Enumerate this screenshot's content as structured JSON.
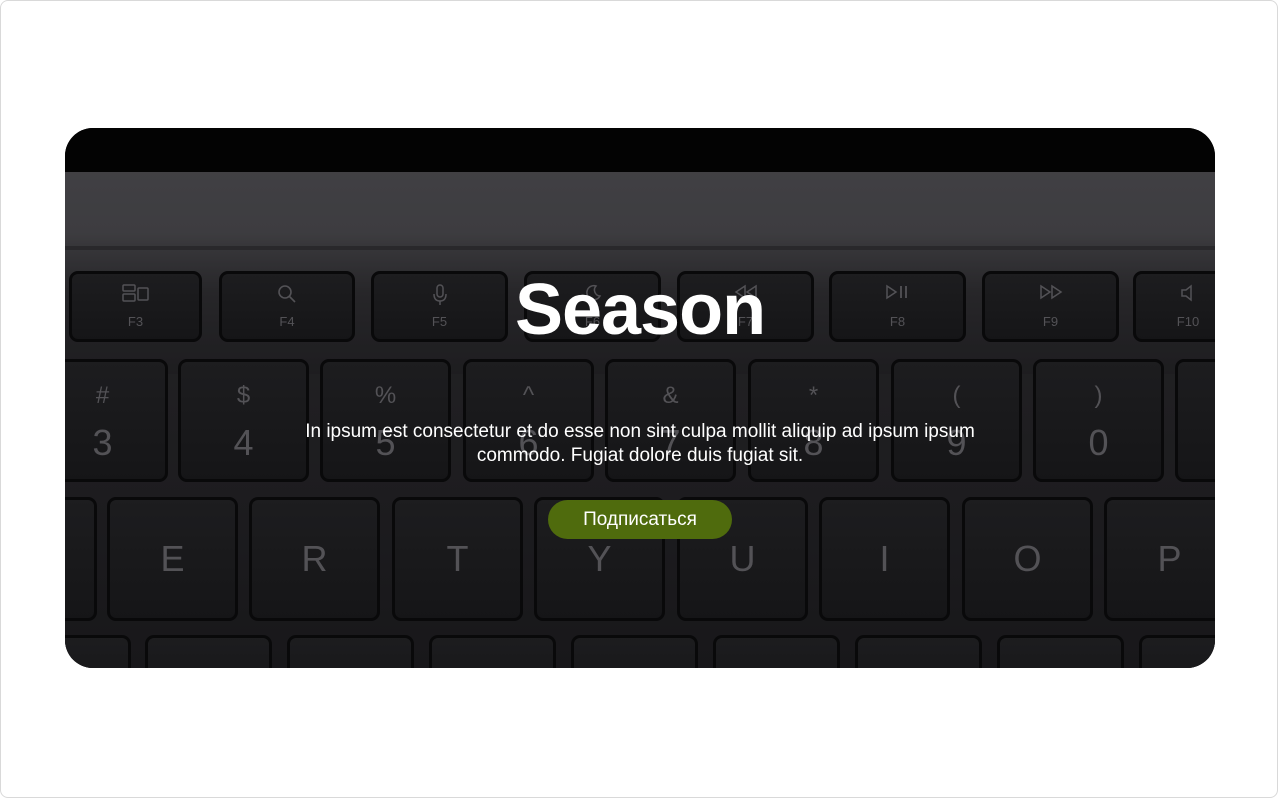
{
  "hero": {
    "title": "Season",
    "description": "In ipsum est consectetur et do esse non sint culpa mollit aliquip ad ipsum ipsum commodo. Fugiat dolore duis fugiat sit.",
    "cta_label": "Подписаться",
    "cta_color": "#4f6b0d"
  },
  "keyboard": {
    "function_keys": [
      "F3",
      "F4",
      "F5",
      "F6",
      "F7",
      "F8",
      "F9",
      "F10"
    ],
    "number_keys": [
      {
        "sym": "#",
        "num": "3"
      },
      {
        "sym": "$",
        "num": "4"
      },
      {
        "sym": "%",
        "num": "5"
      },
      {
        "sym": "^",
        "num": "6"
      },
      {
        "sym": "&",
        "num": "7"
      },
      {
        "sym": "*",
        "num": "8"
      },
      {
        "sym": "(",
        "num": "9"
      },
      {
        "sym": ")",
        "num": "0"
      }
    ],
    "letter_keys": [
      "E",
      "R",
      "T",
      "Y",
      "U",
      "I",
      "O",
      "P"
    ]
  },
  "icons": {
    "f3": "mission-control-icon",
    "f4": "search-icon",
    "f5": "microphone-icon",
    "f6": "moon-icon",
    "f7": "rewind-icon",
    "f8": "play-pause-icon",
    "f9": "fast-forward-icon",
    "f10": "speaker-icon"
  }
}
